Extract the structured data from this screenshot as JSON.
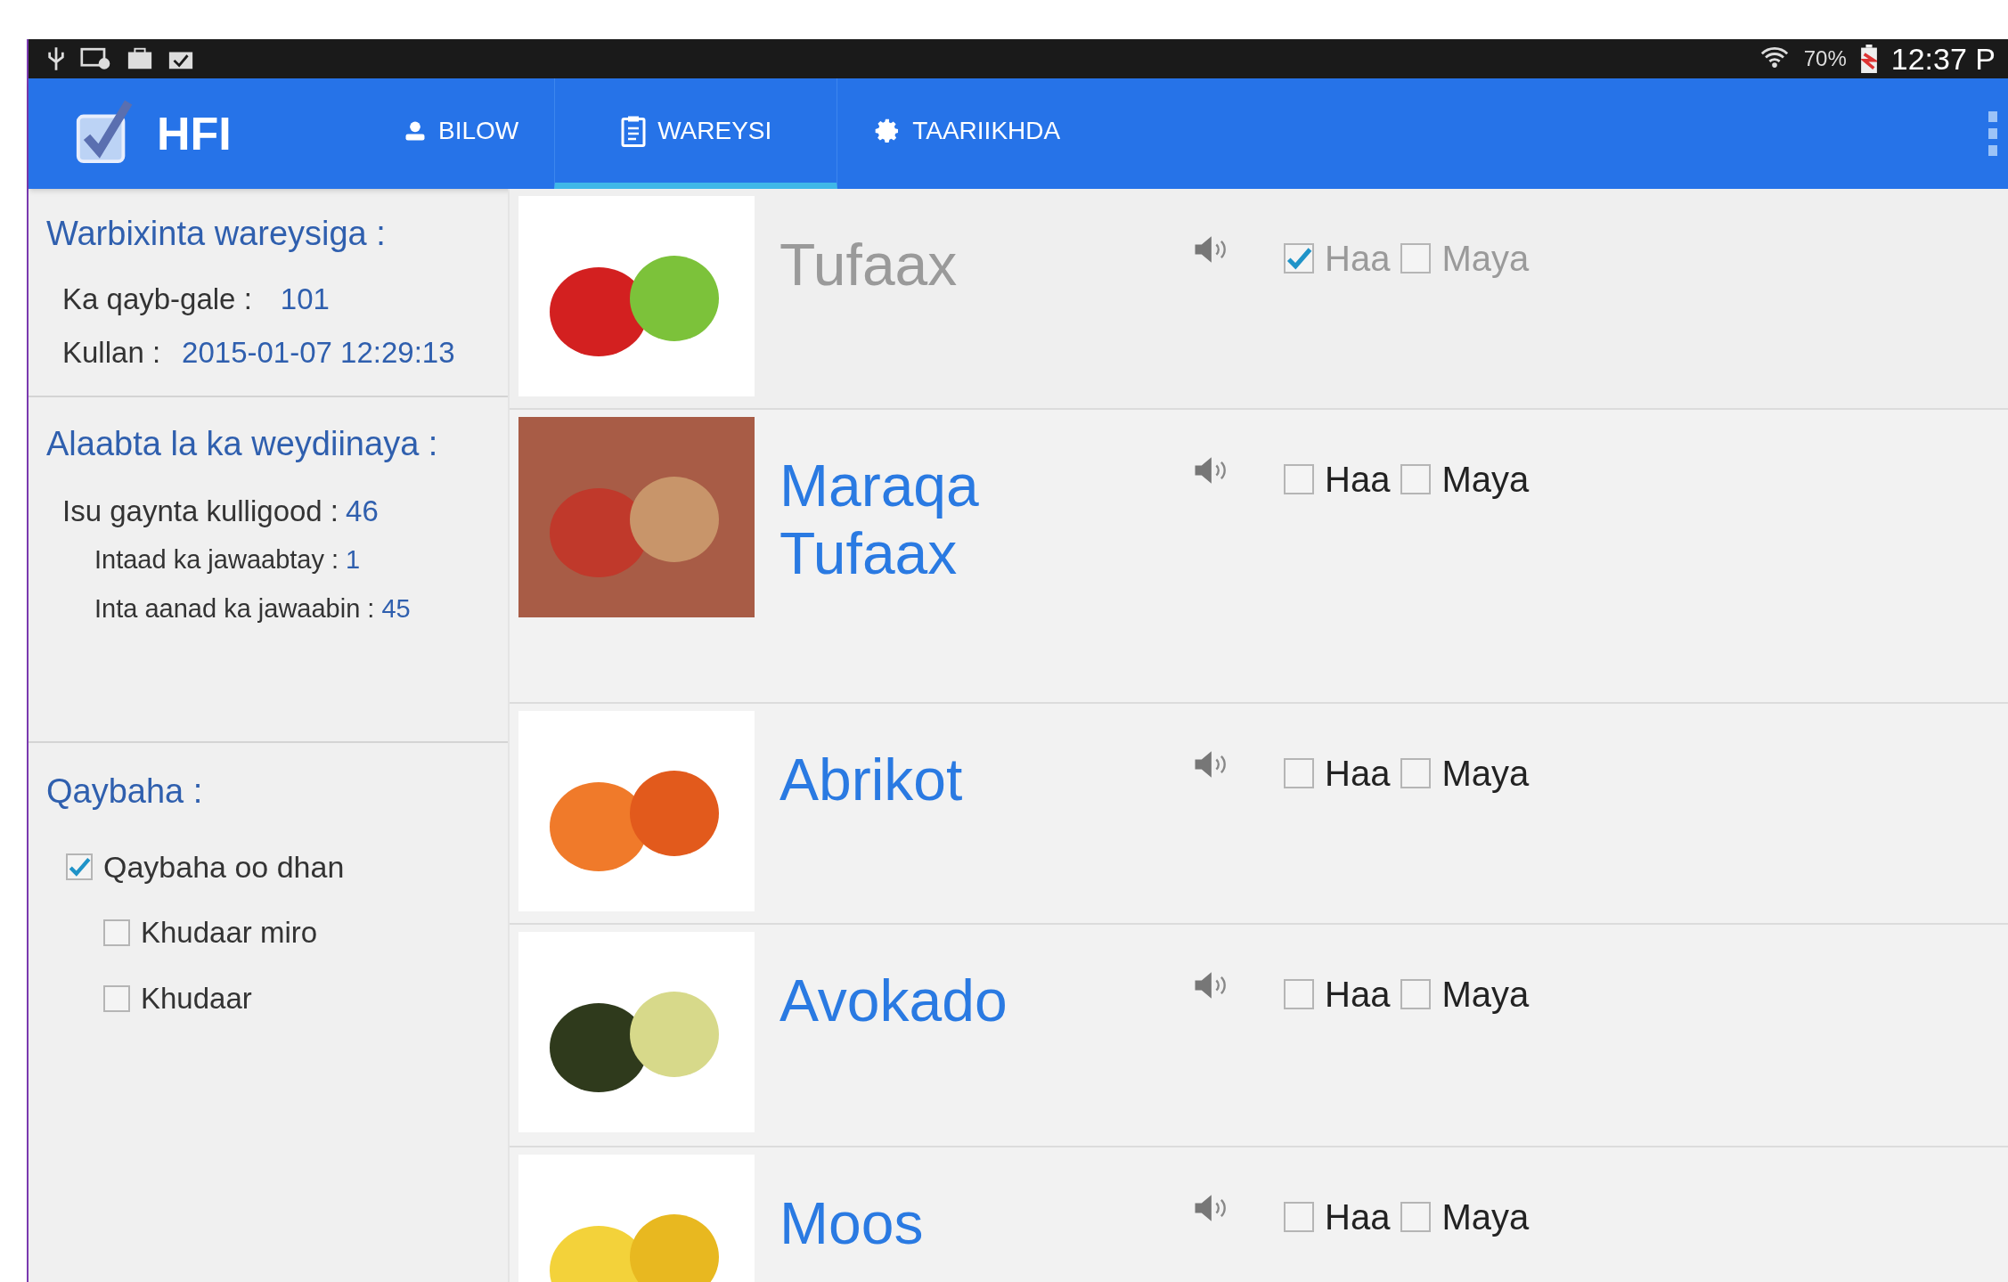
{
  "status_bar": {
    "battery": "70%",
    "time": "12:37 P"
  },
  "app_bar": {
    "title": "HFI",
    "tabs": [
      {
        "label": "BILOW",
        "selected": false
      },
      {
        "label": "WAREYSI",
        "selected": true
      },
      {
        "label": "TAARIIKHDA",
        "selected": false
      }
    ]
  },
  "sidebar": {
    "report": {
      "title": "Warbixinta wareysiga :",
      "participants_label": "Ka qayb-gale :",
      "participants": "101",
      "date_label": "Kullan :",
      "date": "2015-01-07 12:29:13"
    },
    "items": {
      "title": "Alaabta la ka weydiinaya :",
      "total_label": "Isu gaynta kulligood :",
      "total": "46",
      "answered_label": "Intaad ka jawaabtay :",
      "answered": "1",
      "unanswered_label": "Inta aanad ka jawaabin :",
      "unanswered": "45"
    },
    "categories": {
      "title": "Qaybaha :",
      "items": [
        {
          "label": "Qaybaha oo dhan",
          "checked": true,
          "children": [
            {
              "label": "Khudaar miro",
              "checked": false
            },
            {
              "label": "Khudaar",
              "checked": false
            }
          ]
        }
      ]
    }
  },
  "rows": [
    {
      "name": "Tufaax",
      "answered": true,
      "options": [
        {
          "label": "Haa",
          "checked": true
        },
        {
          "label": "Maya",
          "checked": false
        }
      ]
    },
    {
      "name": "Maraqa Tufaax",
      "answered": false,
      "options": [
        {
          "label": "Haa",
          "checked": false
        },
        {
          "label": "Maya",
          "checked": false
        }
      ]
    },
    {
      "name": "Abrikot",
      "answered": false,
      "options": [
        {
          "label": "Haa",
          "checked": false
        },
        {
          "label": "Maya",
          "checked": false
        }
      ]
    },
    {
      "name": "Avokado",
      "answered": false,
      "options": [
        {
          "label": "Haa",
          "checked": false
        },
        {
          "label": "Maya",
          "checked": false
        }
      ]
    },
    {
      "name": "Moos",
      "answered": false,
      "options": [
        {
          "label": "Haa",
          "checked": false
        },
        {
          "label": "Maya",
          "checked": false
        }
      ]
    }
  ]
}
